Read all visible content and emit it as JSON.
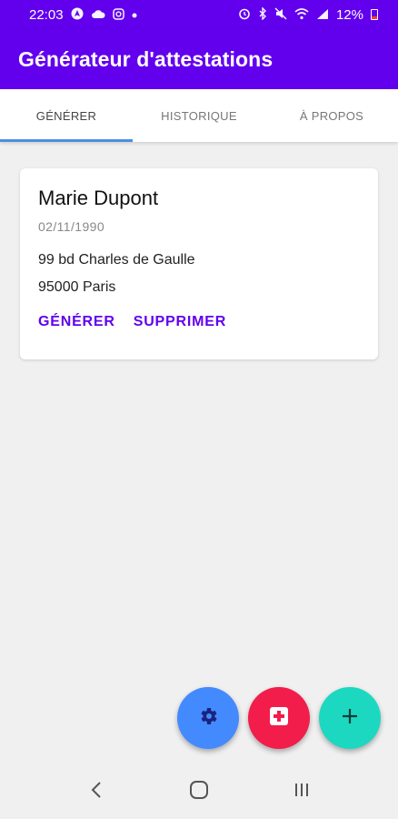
{
  "status_bar": {
    "time": "22:03",
    "battery": "12%",
    "left_icons": [
      "navigation-icon",
      "cloud-icon",
      "instagram-icon",
      "dot-icon"
    ],
    "right_icons": [
      "alarm-icon",
      "bluetooth-icon",
      "mute-icon",
      "wifi-icon",
      "signal-icon",
      "battery-icon"
    ]
  },
  "app_bar": {
    "title": "Générateur d'attestations",
    "color": "#6200ee"
  },
  "tabs": [
    {
      "label": "GÉNÉRER",
      "active": true
    },
    {
      "label": "HISTORIQUE",
      "active": false
    },
    {
      "label": "À PROPOS",
      "active": false
    }
  ],
  "card": {
    "name": "Marie Dupont",
    "birth_date": "02/11/1990",
    "address_line1": "99 bd Charles de Gaulle",
    "address_line2": "95000 Paris",
    "actions": {
      "generate": "GÉNÉRER",
      "delete": "SUPPRIMER"
    }
  },
  "fabs": [
    {
      "icon": "gear-icon",
      "color": "#448aff"
    },
    {
      "icon": "medical-cross-icon",
      "color": "#f21d4a"
    },
    {
      "icon": "plus-icon",
      "color": "#1dd8c0"
    }
  ],
  "nav_bar": {
    "icons": [
      "back-icon",
      "home-icon",
      "recents-icon"
    ]
  }
}
